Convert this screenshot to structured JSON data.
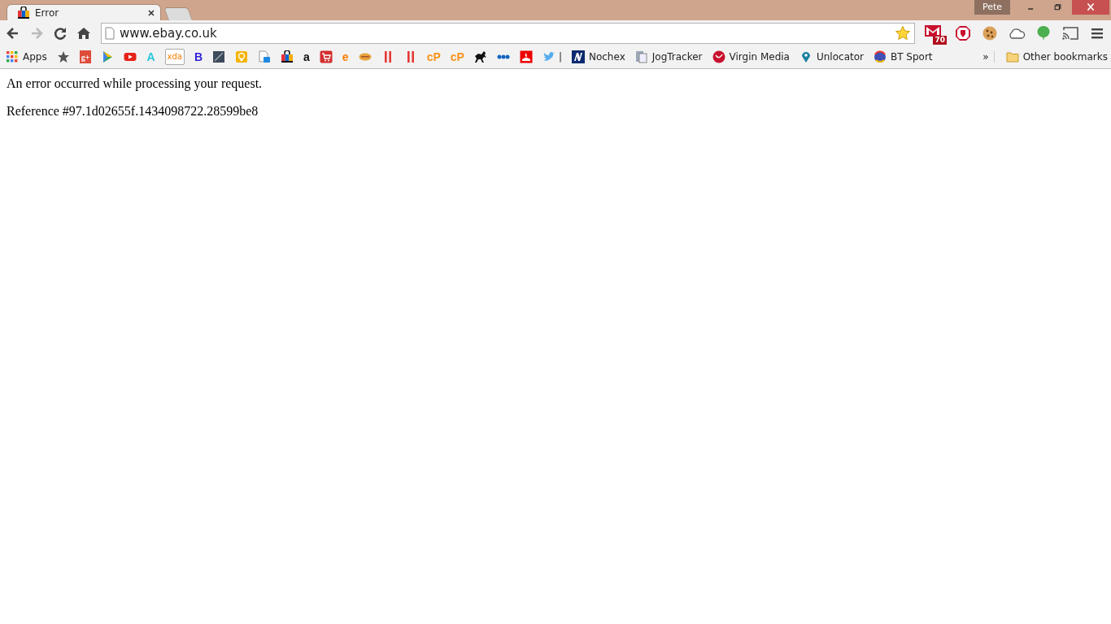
{
  "tabs": [
    {
      "title": "Error",
      "selected": true
    },
    {
      "selected": false
    }
  ],
  "profile": "Pete",
  "toolbar": {
    "back_disabled": false,
    "forward_disabled": true
  },
  "address": {
    "value": "www.ebay.co.uk",
    "starred": true
  },
  "extensions": [
    {
      "kind": "mail",
      "badge": "70"
    },
    {
      "kind": "stop"
    },
    {
      "kind": "cookie"
    },
    {
      "kind": "cloud"
    },
    {
      "kind": "leaf"
    },
    {
      "kind": "cast"
    }
  ],
  "apps_label": "Apps",
  "bookmarks": [
    {
      "kind": "star",
      "color": "#555555"
    },
    {
      "kind": "tile",
      "glyph": "g+",
      "color": "#dd4b39"
    },
    {
      "kind": "play",
      "color": "#34a853"
    },
    {
      "kind": "video",
      "color": "#e62117"
    },
    {
      "kind": "letter",
      "glyph": "A",
      "color": "#26c6da"
    },
    {
      "kind": "framed",
      "glyph": "xda",
      "color": "#f57c00"
    },
    {
      "kind": "letter",
      "glyph": "B",
      "color": "#2f1fd8"
    },
    {
      "kind": "slash",
      "color": "#3d4a5c"
    },
    {
      "kind": "bulb",
      "color": "#f4b400"
    },
    {
      "kind": "doc",
      "color": "#1e88e5"
    },
    {
      "kind": "bag",
      "color": "#e53238"
    },
    {
      "kind": "letter",
      "glyph": "a",
      "color": "#111111"
    },
    {
      "kind": "cart",
      "color": "#d32f2f"
    },
    {
      "kind": "letter",
      "glyph": "e",
      "color": "#f57c00"
    },
    {
      "kind": "oval",
      "color": "#e8a33a"
    },
    {
      "kind": "bars",
      "color": "#e53935"
    },
    {
      "kind": "bars",
      "color": "#e53935"
    },
    {
      "kind": "letter",
      "glyph": "cP",
      "color": "#f7941d"
    },
    {
      "kind": "letter",
      "glyph": "cP",
      "color": "#f7941d"
    },
    {
      "kind": "horse",
      "color": "#111111"
    },
    {
      "kind": "dots",
      "color": "#1565c0"
    },
    {
      "kind": "flame",
      "color": "#ec0000"
    },
    {
      "kind": "bird",
      "color": "#55acee"
    }
  ],
  "separator": "|",
  "named_bookmarks": [
    {
      "label": "Nochex",
      "kind": "square",
      "color": "#0b2a6f"
    },
    {
      "label": "JogTracker",
      "kind": "page",
      "color": "#9aa7b8"
    },
    {
      "label": "Virgin Media",
      "kind": "circle",
      "color": "#c8102e"
    },
    {
      "label": "Unlocator",
      "kind": "pin",
      "color": "#1a7fa0"
    },
    {
      "label": "BT Sport",
      "kind": "globe",
      "color": "#3f51b5"
    }
  ],
  "overflow": "»",
  "other_bookmarks": "Other bookmarks",
  "page": {
    "message": "An error occurred while processing your request.",
    "reference": "Reference #97.1d02655f.1434098722.28599be8"
  }
}
